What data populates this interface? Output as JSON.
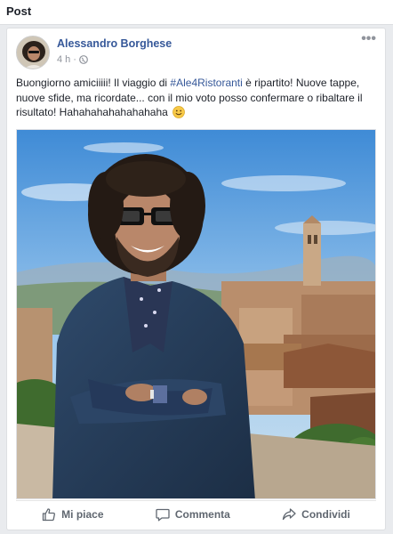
{
  "section": {
    "title": "Post"
  },
  "post": {
    "author": "Alessandro Borghese",
    "time": "4 h",
    "dot": "·",
    "text_before": "Buongiorno amiciiiii! Il viaggio di ",
    "hashtag": "#Ale4Ristoranti",
    "text_after": " è ripartito! Nuove tappe, nuove sfide, ma ricordate... con il mio voto posso confermare o ribaltare il risultato! Hahahahahahahahaha",
    "more_label": "•••",
    "privacy_icon": "globe-icon",
    "emoji_icon": "smiley-icon"
  },
  "actions": {
    "like": "Mi piace",
    "comment": "Commenta",
    "share": "Condividi"
  },
  "colors": {
    "link": "#365899",
    "background": "#e9ebee",
    "meta": "#90949c"
  }
}
